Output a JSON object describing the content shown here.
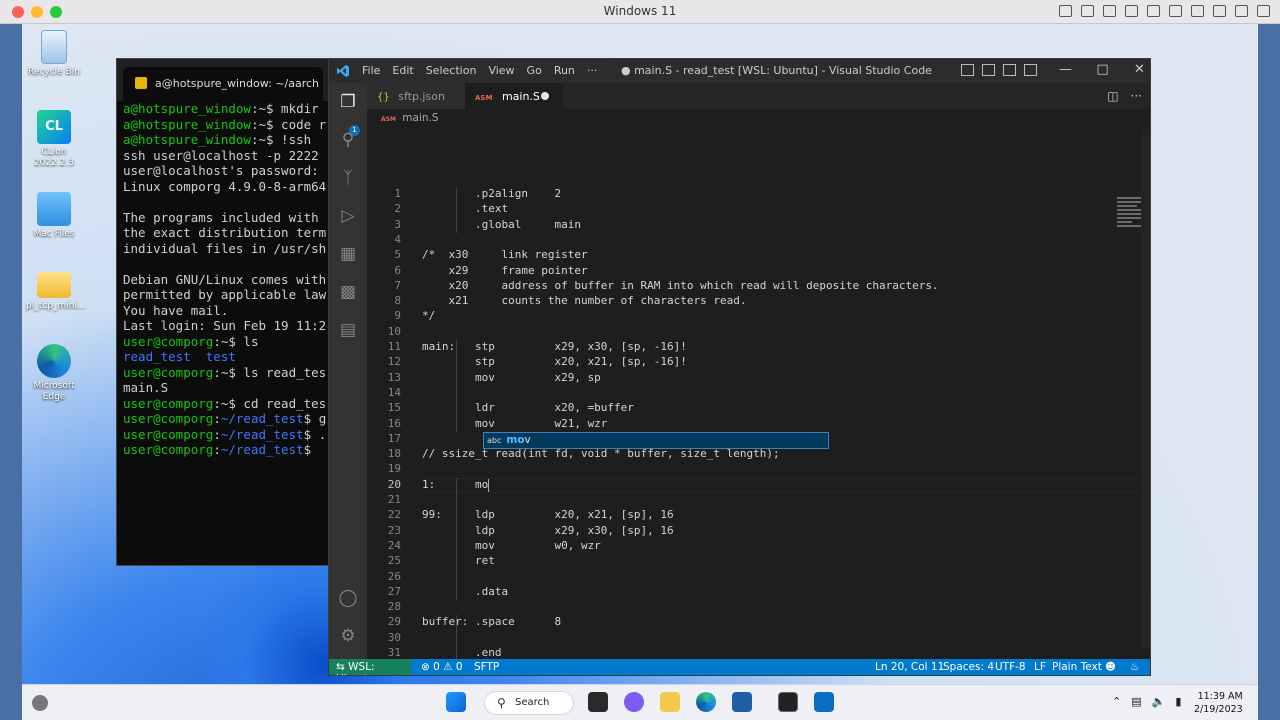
{
  "mac": {
    "title": "Windows 11"
  },
  "desktop_icons": [
    {
      "label": "Recycle Bin"
    },
    {
      "label": "CLion 2022.2.3"
    },
    {
      "label": "Mac Files"
    },
    {
      "label": "pi_tcp_mini..."
    },
    {
      "label": "Microsoft Edge"
    }
  ],
  "terminal": {
    "tab_title": "a@hotspure_window: ~/aarch",
    "lines": [
      [
        {
          "t": "a@hotspure_window",
          "c": "g"
        },
        {
          "t": ":~$ mkdir r"
        }
      ],
      [
        {
          "t": "a@hotspure_window",
          "c": "g"
        },
        {
          "t": ":~$ code r"
        }
      ],
      [
        {
          "t": "a@hotspure_window",
          "c": "g"
        },
        {
          "t": ":~$ !ssh"
        }
      ],
      [
        {
          "t": "ssh user@localhost -p 2222"
        }
      ],
      [
        {
          "t": "user@localhost's password:"
        }
      ],
      [
        {
          "t": "Linux comporg 4.9.0-8-arm64"
        }
      ],
      [
        {
          "t": ""
        }
      ],
      [
        {
          "t": "The programs included with"
        }
      ],
      [
        {
          "t": "the exact distribution term"
        }
      ],
      [
        {
          "t": "individual files in /usr/sh"
        }
      ],
      [
        {
          "t": ""
        }
      ],
      [
        {
          "t": "Debian GNU/Linux comes with"
        }
      ],
      [
        {
          "t": "permitted by applicable law"
        }
      ],
      [
        {
          "t": "You have mail."
        }
      ],
      [
        {
          "t": "Last login: Sun Feb 19 11:2"
        }
      ],
      [
        {
          "t": "user@comporg",
          "c": "g"
        },
        {
          "t": ":~$ ls"
        }
      ],
      [
        {
          "t": "read_test  test",
          "c": "b"
        }
      ],
      [
        {
          "t": "user@comporg",
          "c": "g"
        },
        {
          "t": ":~$ ls read_tes"
        }
      ],
      [
        {
          "t": "main.S"
        }
      ],
      [
        {
          "t": "user@comporg",
          "c": "g"
        },
        {
          "t": ":~$ cd read_tes"
        }
      ],
      [
        {
          "t": "user@comporg",
          "c": "g"
        },
        {
          "t": ":"
        },
        {
          "t": "~/read_test",
          "c": "b"
        },
        {
          "t": "$ g"
        }
      ],
      [
        {
          "t": "user@comporg",
          "c": "g"
        },
        {
          "t": ":"
        },
        {
          "t": "~/read_test",
          "c": "b"
        },
        {
          "t": "$ ."
        }
      ],
      [
        {
          "t": "user@comporg",
          "c": "g"
        },
        {
          "t": ":"
        },
        {
          "t": "~/read_test",
          "c": "b"
        },
        {
          "t": "$"
        }
      ]
    ]
  },
  "vscode": {
    "menu": [
      "File",
      "Edit",
      "Selection",
      "View",
      "Go",
      "Run",
      "···"
    ],
    "window_title": "● main.S - read_test [WSL: Ubuntu] - Visual Studio Code",
    "tabs": [
      {
        "icon": "{}",
        "label": "sftp.json"
      },
      {
        "icon": "ASM",
        "label": "main.S"
      }
    ],
    "breadcrumb": {
      "icon": "ASM",
      "label": "main.S"
    },
    "code": [
      "        .p2align    2",
      "        .text",
      "        .global     main",
      "",
      "/*  x30     link register",
      "    x29     frame pointer",
      "    x20     address of buffer in RAM into which read will deposite characters.",
      "    x21     counts the number of characters read.",
      "*/",
      "",
      "main:   stp         x29, x30, [sp, -16]!",
      "        stp         x20, x21, [sp, -16]!",
      "        mov         x29, sp",
      "",
      "        ldr         x20, =buffer",
      "        mov         w21, wzr",
      "",
      "// ssize_t read(int fd, void * buffer, size_t length);",
      "",
      "1:      mo",
      "",
      "99:     ldp         x20, x21, [sp], 16",
      "        ldp         x29, x30, [sp], 16",
      "        mov         w0, wzr",
      "        ret",
      "",
      "        .data",
      "",
      "buffer: .space      8",
      "",
      "        .end",
      ""
    ],
    "current_line": 20,
    "suggestion": {
      "kind": "abc",
      "match": "mo",
      "rest": "v"
    },
    "status": {
      "remote": "WSL: Ubuntu",
      "problems": "⊗ 0 ⚠ 0",
      "sftp": "SFTP",
      "position": "Ln 20, Col 11",
      "spaces": "Spaces: 4",
      "encoding": "UTF-8",
      "eol": "LF",
      "language": "Plain Text"
    }
  },
  "taskbar": {
    "search_label": "Search",
    "time": "11:39 AM",
    "date": "2/19/2023"
  }
}
